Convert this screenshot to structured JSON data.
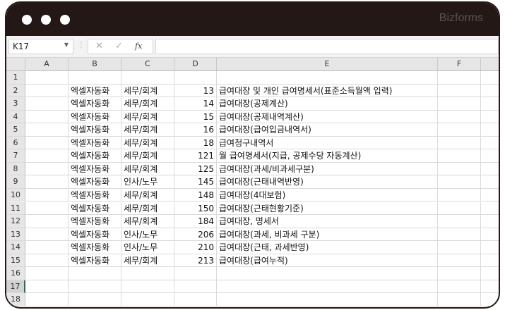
{
  "window": {
    "brand": "Bizforms"
  },
  "formula_bar": {
    "name_box": "K17",
    "cancel": "✕",
    "enter": "✓",
    "fx": "fx",
    "formula": ""
  },
  "columns": [
    "A",
    "B",
    "C",
    "D",
    "E",
    "F"
  ],
  "rows": [
    {
      "n": "1",
      "b": "",
      "c": "",
      "d": "",
      "e": ""
    },
    {
      "n": "2",
      "b": "엑셀자동화",
      "c": "세무/회계",
      "d": "13",
      "e": "급여대장 및 개인 급여명세서(표준소득월액 입력)"
    },
    {
      "n": "3",
      "b": "엑셀자동화",
      "c": "세무/회계",
      "d": "14",
      "e": "급여대장(공제계산)"
    },
    {
      "n": "4",
      "b": "엑셀자동화",
      "c": "세무/회계",
      "d": "15",
      "e": "급여대장(공제내역계산)"
    },
    {
      "n": "5",
      "b": "엑셀자동화",
      "c": "세무/회계",
      "d": "16",
      "e": "급여대장(급여입금내역서)"
    },
    {
      "n": "6",
      "b": "엑셀자동화",
      "c": "세무/회계",
      "d": "18",
      "e": "급여청구내역서"
    },
    {
      "n": "7",
      "b": "엑셀자동화",
      "c": "세무/회계",
      "d": "121",
      "e": "월 급여명세서(지급, 공제수당 자동계산)"
    },
    {
      "n": "8",
      "b": "엑셀자동화",
      "c": "세무/회계",
      "d": "125",
      "e": "급여대장(과세/비과세구분)"
    },
    {
      "n": "9",
      "b": "엑셀자동화",
      "c": "인사/노무",
      "d": "145",
      "e": "급여대장(근태내역반영)"
    },
    {
      "n": "10",
      "b": "엑셀자동화",
      "c": "세무/회계",
      "d": "148",
      "e": "급여대장(4대보험)"
    },
    {
      "n": "11",
      "b": "엑셀자동화",
      "c": "세무/회계",
      "d": "150",
      "e": "급여대장(근태현황기준)"
    },
    {
      "n": "12",
      "b": "엑셀자동화",
      "c": "세무/회계",
      "d": "184",
      "e": "급여대장, 명세서"
    },
    {
      "n": "13",
      "b": "엑셀자동화",
      "c": "인사/노무",
      "d": "206",
      "e": "급여대장(과세, 비과세 구분)"
    },
    {
      "n": "14",
      "b": "엑셀자동화",
      "c": "인사/노무",
      "d": "210",
      "e": "급여대장(근태, 과세반영)"
    },
    {
      "n": "15",
      "b": "엑셀자동화",
      "c": "세무/회계",
      "d": "213",
      "e": "급여대장(급여누적)"
    },
    {
      "n": "16",
      "b": "",
      "c": "",
      "d": "",
      "e": ""
    },
    {
      "n": "17",
      "b": "",
      "c": "",
      "d": "",
      "e": ""
    },
    {
      "n": "18",
      "b": "",
      "c": "",
      "d": "",
      "e": ""
    }
  ],
  "selected_row": "17"
}
